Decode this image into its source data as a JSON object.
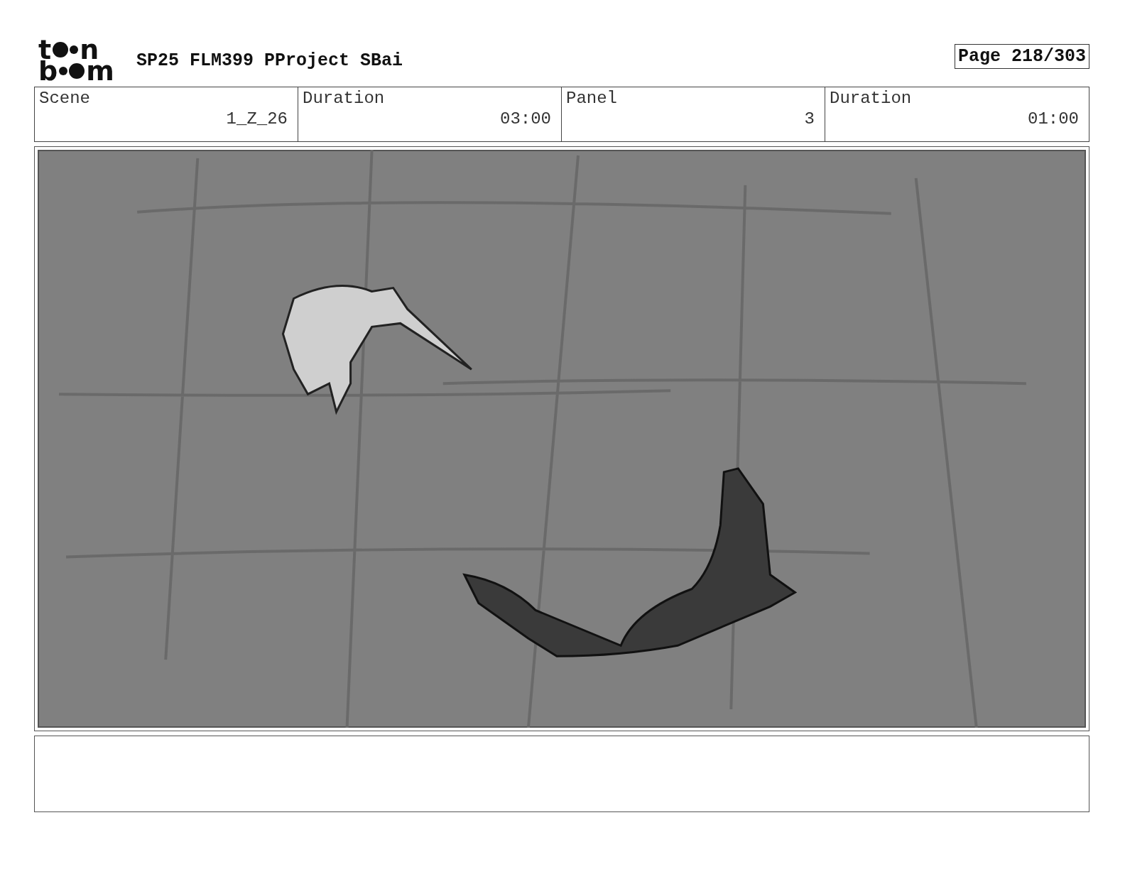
{
  "logo": {
    "top": [
      "t",
      "n"
    ],
    "bottom": [
      "b",
      "m"
    ]
  },
  "project_title": "SP25 FLM399 PProject SBai",
  "page_number": "Page 218/303",
  "fields": [
    {
      "label": "Scene",
      "value": "1_Z_26"
    },
    {
      "label": "Duration",
      "value": "03:00"
    },
    {
      "label": "Panel",
      "value": "3"
    },
    {
      "label": "Duration",
      "value": "01:00"
    }
  ]
}
